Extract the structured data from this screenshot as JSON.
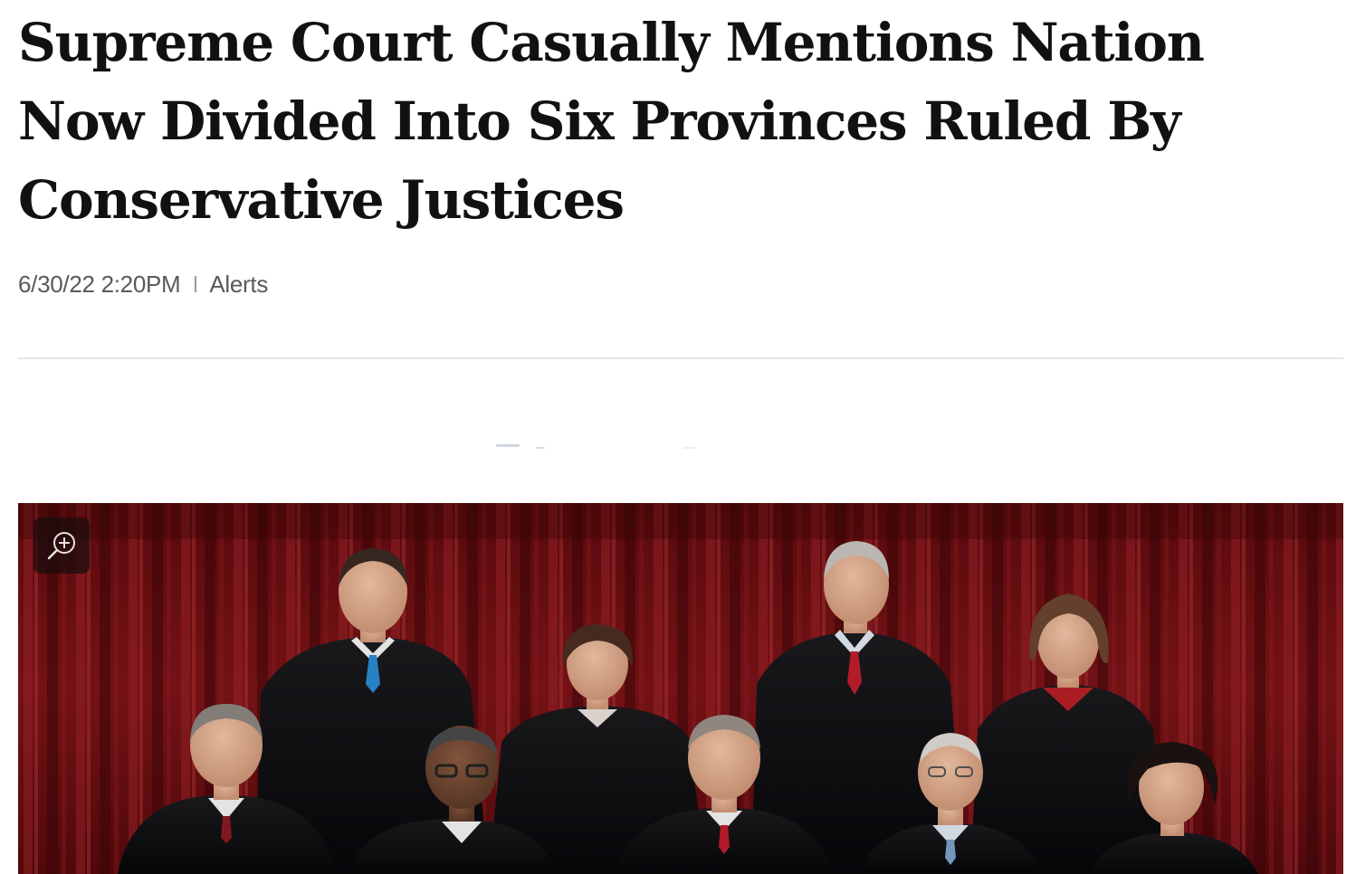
{
  "article": {
    "headline": "Supreme Court Casually Mentions Nation Now Divided Into Six Provinces Ruled By Conservative Justices",
    "headline_lines": [
      "Supreme Court Casually Mentions Nation",
      "Now Divided Into Six Provinces Ruled By",
      "Conservative Justices"
    ],
    "timestamp": "6/30/22 2:20PM",
    "section": "Alerts"
  },
  "photo": {
    "zoom_icon": "zoom-in-icon"
  },
  "colors": {
    "headline": "#111111",
    "meta": "#5a5a5a",
    "curtain": "#7a1216",
    "robe": "#0e0e10",
    "divider": "#e6e6e6"
  }
}
